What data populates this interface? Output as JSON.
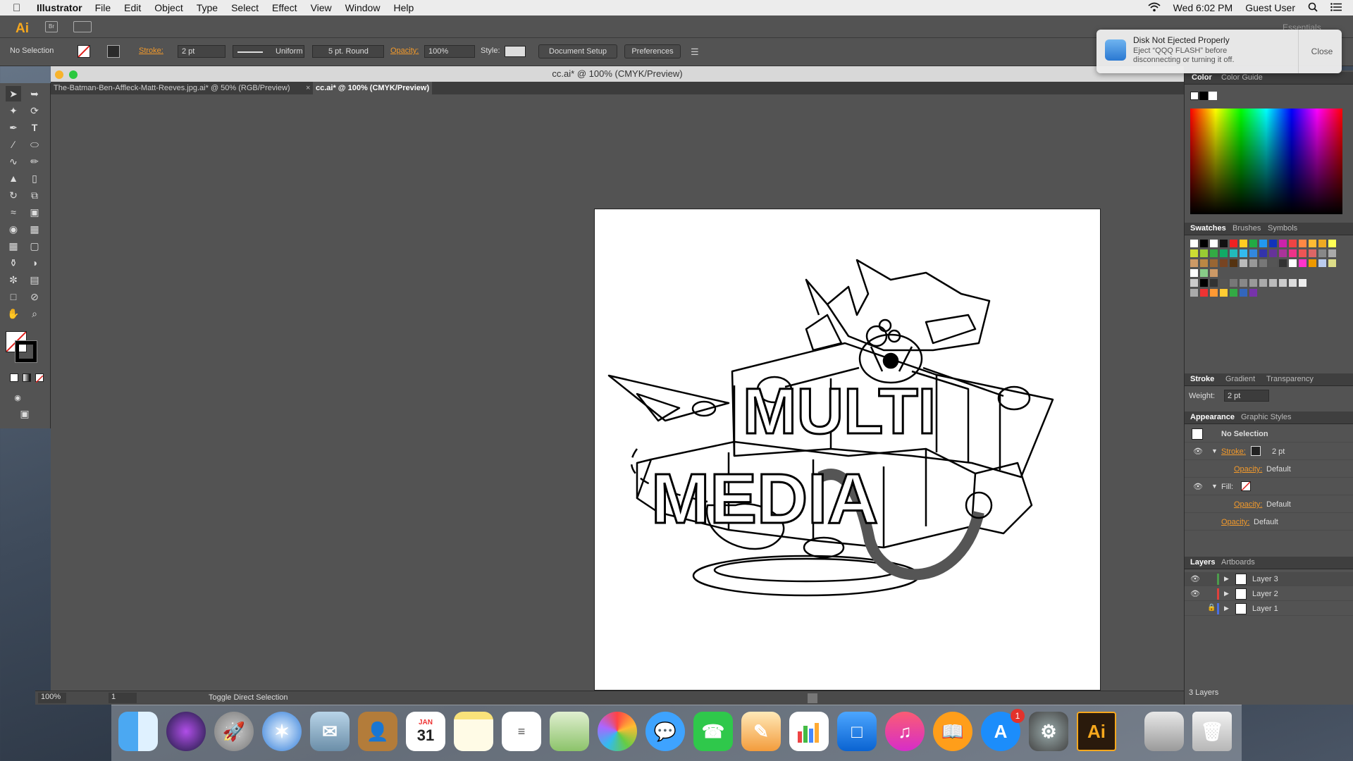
{
  "menubar": {
    "app_name": "Illustrator",
    "items": [
      "File",
      "Edit",
      "Object",
      "Type",
      "Select",
      "Effect",
      "View",
      "Window",
      "Help"
    ],
    "clock": "Wed 6:02 PM",
    "user": "Guest User"
  },
  "appbar": {
    "logo": "Ai",
    "workspace": "Essentials"
  },
  "controlbar": {
    "selection": "No Selection",
    "stroke_label": "Stroke:",
    "stroke_weight": "2 pt",
    "profile": "Uniform",
    "brush": "5 pt. Round",
    "opacity_label": "Opacity:",
    "opacity_value": "100%",
    "style_label": "Style:",
    "document_setup": "Document Setup",
    "preferences": "Preferences"
  },
  "document": {
    "title": "cc.ai* @ 100% (CMYK/Preview)",
    "tabs": [
      {
        "label": "The-Batman-Ben-Affleck-Matt-Reeves.jpg.ai* @ 50% (RGB/Preview)"
      },
      {
        "label": "cc.ai* @ 100% (CMYK/Preview)"
      }
    ],
    "tab_close": "×"
  },
  "statusbar": {
    "zoom": "100%",
    "page": "1",
    "status": "Toggle Direct Selection"
  },
  "notification": {
    "title": "Disk Not Ejected Properly",
    "body": "Eject “QQQ FLASH” before disconnecting or turning it off.",
    "close": "Close"
  },
  "panels": {
    "color_tabs": [
      "Color",
      "Color Guide"
    ],
    "swatch_tabs": [
      "Swatches",
      "Brushes",
      "Symbols"
    ],
    "stroke_tabs": [
      "Stroke",
      "Gradient",
      "Transparency"
    ],
    "weight_label": "Weight:",
    "weight_value": "2 pt",
    "appearance_tabs": [
      "Appearance",
      "Graphic Styles"
    ],
    "appearance": {
      "header": "No Selection",
      "stroke_label": "Stroke:",
      "stroke_value": "2 pt",
      "opacity_label": "Opacity:",
      "opacity_value": "Default",
      "fill_label": "Fill:",
      "fill_opacity_label": "Opacity:",
      "fill_opacity_value": "Default",
      "opacity2_label": "Opacity:",
      "opacity2_value": "Default"
    },
    "layers_tabs": [
      "Layers",
      "Artboards"
    ],
    "layers": [
      {
        "name": "Layer 3",
        "color": "#4c9c4c"
      },
      {
        "name": "Layer 2",
        "color": "#e0403c"
      },
      {
        "name": "Layer 1",
        "color": "#4a6fe0"
      }
    ],
    "layers_count": "3 Layers"
  },
  "artwork": {
    "line1": "MULTI",
    "line2": "MEDIA"
  },
  "dock": {
    "calendar_month": "JAN",
    "calendar_day": "31",
    "appstore_badge": "1",
    "illustrator_label": "Ai"
  }
}
